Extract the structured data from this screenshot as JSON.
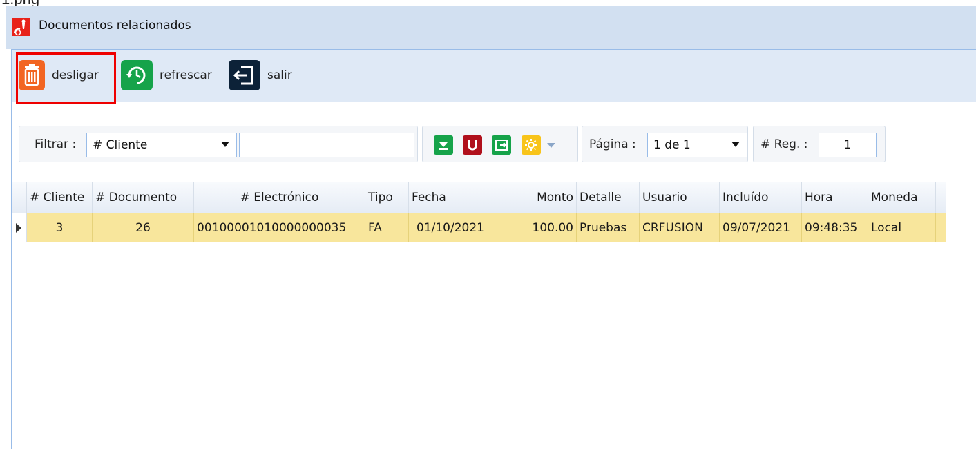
{
  "file_caption": "1.png",
  "window": {
    "title": "Documentos relacionados"
  },
  "toolbar": {
    "unlink_label": "desligar",
    "refresh_label": "refrescar",
    "exit_label": "salir"
  },
  "filter": {
    "label": "Filtrar :",
    "field_value": "# Cliente",
    "text_value": ""
  },
  "pagination": {
    "page_label": "Página :",
    "page_value": "1 de 1",
    "reg_label": "# Reg. :",
    "reg_value": "1"
  },
  "grid": {
    "columns": [
      "# Cliente",
      "# Documento",
      "# Electrónico",
      "Tipo",
      "Fecha",
      "Monto",
      "Detalle",
      "Usuario",
      "Incluído",
      "Hora",
      "Moneda"
    ],
    "rows": [
      [
        "3",
        "26",
        "00100001010000000035",
        "FA",
        "01/10/2021",
        "100.00",
        "Pruebas",
        "CRFUSION",
        "09/07/2021",
        "09:48:35",
        "Local"
      ]
    ]
  },
  "colors": {
    "accent_border": "#99bce8",
    "selected_row": "#f8e69c",
    "highlight": "#ee0000"
  },
  "icons": [
    "app-icon",
    "trash-icon",
    "refresh-clock-icon",
    "exit-icon",
    "export-excel-icon",
    "unlock-icon",
    "export-icon",
    "theme-icon"
  ]
}
